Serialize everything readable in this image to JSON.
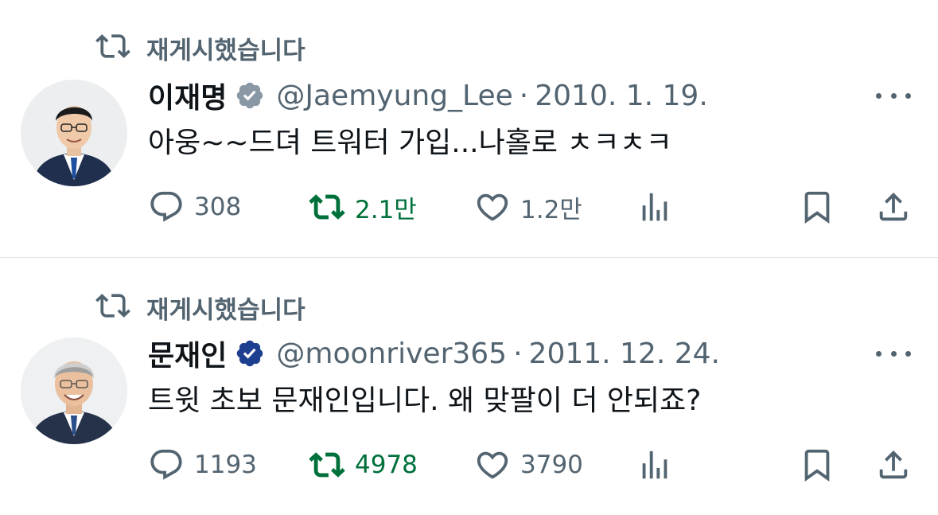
{
  "colors": {
    "text_primary": "#0f1419",
    "text_secondary": "#536471",
    "retweet_active": "#00703b",
    "badge_gray": "#8a97a4",
    "badge_blue": "#1d3f8f",
    "divider": "#e3e7ea"
  },
  "tweets": [
    {
      "retweet_label": "재게시했습니다",
      "display_name": "이재명",
      "badge": "gray-verified-badge-icon",
      "handle": "@Jaemyung_Lee",
      "separator": "·",
      "date": "2010. 1. 19.",
      "text": "아웅~~드뎌 트워터 가입...나홀로 ㅊㅋㅊㅋ",
      "reply_count": "308",
      "retweet_count": "2.1만",
      "like_count": "1.2만"
    },
    {
      "retweet_label": "재게시했습니다",
      "display_name": "문재인",
      "badge": "blue-verified-badge-icon",
      "handle": "@moonriver365",
      "separator": "·",
      "date": "2011. 12. 24.",
      "text": "트윗 초보 문재인입니다. 왜 맞팔이 더 안되죠?",
      "reply_count": "1193",
      "retweet_count": "4978",
      "like_count": "3790"
    }
  ]
}
